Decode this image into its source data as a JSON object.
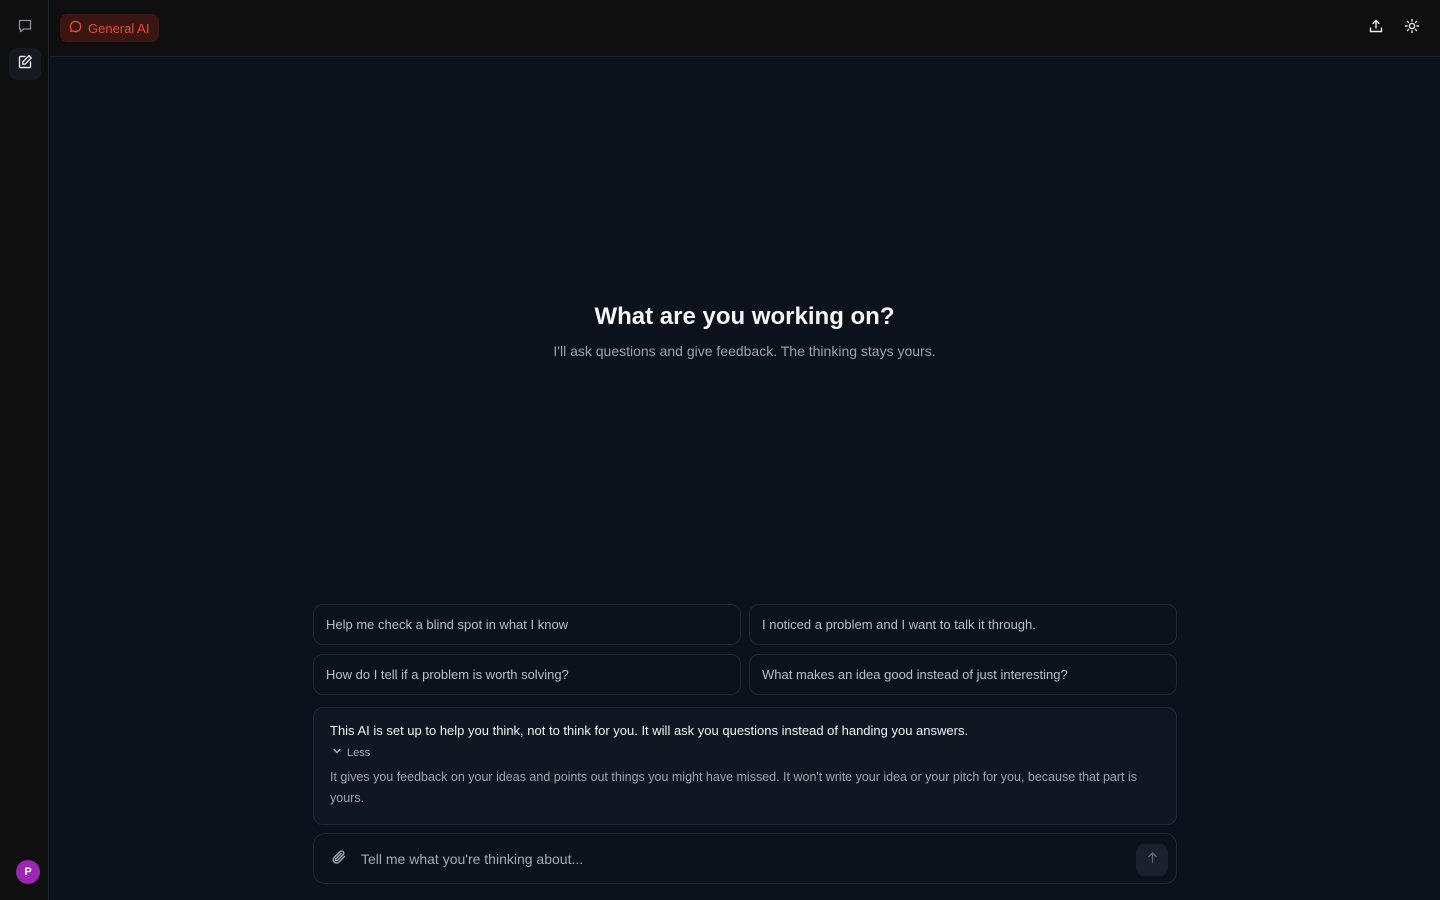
{
  "sidebar": {
    "chats_icon": "chat-bubble-icon",
    "new_chat_icon": "edit-icon",
    "avatar_letter": "P",
    "avatar_color": "#9b27b0"
  },
  "header": {
    "mode_label": "General AI",
    "mode_color": "#f0462f",
    "share_icon": "upload-icon",
    "theme_icon": "sun-icon"
  },
  "hero": {
    "title": "What are you working on?",
    "subtitle": "I'll ask questions and give feedback. The thinking stays yours."
  },
  "suggestions": [
    "Help me check a blind spot in what I know",
    "I noticed a problem and I want to talk it through.",
    "How do I tell if a problem is worth solving?",
    "What makes an idea good instead of just interesting?"
  ],
  "info": {
    "main": "This AI is set up to help you think, not to think for you. It will ask you questions instead of handing you answers.",
    "toggle_label": "Less",
    "more": "It gives you feedback on your ideas and points out things you might have missed. It won't write your idea or your pitch for you, because that part is yours."
  },
  "composer": {
    "placeholder": "Tell me what you're thinking about...",
    "value": ""
  }
}
